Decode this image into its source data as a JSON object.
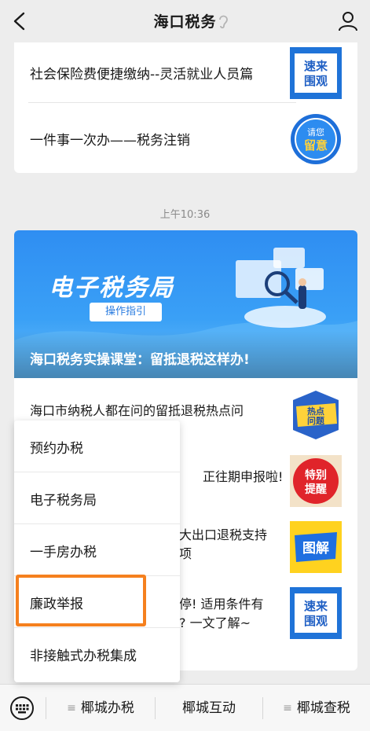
{
  "header": {
    "title": "海口税务"
  },
  "feed": {
    "prev_articles": [
      {
        "title": "社会保险费便捷缴纳--灵活就业人员篇",
        "thumb_text": [
          "速来",
          "围观"
        ]
      },
      {
        "title": "一件事一次办——税务注销",
        "thumb_text": [
          "请您",
          "留意"
        ]
      }
    ],
    "timestamp": "上午10:36",
    "banner": {
      "headline": "电子税务局",
      "pill": "操作指引",
      "caption": "海口税务实操课堂：留抵退税这样办!"
    },
    "list": [
      {
        "line1": "海口市纳税人都在问的留抵退税热点问",
        "line2": "",
        "thumb_text": [
          "热点",
          "问题"
        ]
      },
      {
        "line1": "正往期申报啦!",
        "line2": "",
        "thumb_text": [
          "特别",
          "提醒"
        ]
      },
      {
        "line1": "大出口退税支持",
        "line2": "项",
        "thumb_text": [
          "图解"
        ]
      },
      {
        "line1": "停! 适用条件有",
        "line2": "? 一文了解~",
        "thumb_text": [
          "速来",
          "围观"
        ]
      }
    ]
  },
  "popup_menu": {
    "items": [
      "预约办税",
      "电子税务局",
      "一手房办税",
      "廉政举报",
      "非接触式办税集成"
    ],
    "highlighted_index": 3
  },
  "bottom_menu": {
    "tabs": [
      {
        "label": "椰城办税",
        "has_submenu": true
      },
      {
        "label": "椰城互动",
        "has_submenu": false
      },
      {
        "label": "椰城查税",
        "has_submenu": true
      }
    ]
  },
  "colors": {
    "highlight": "#f5801e",
    "banner": "#2f8ef2",
    "thumb_blue": "#1e6fd9"
  }
}
